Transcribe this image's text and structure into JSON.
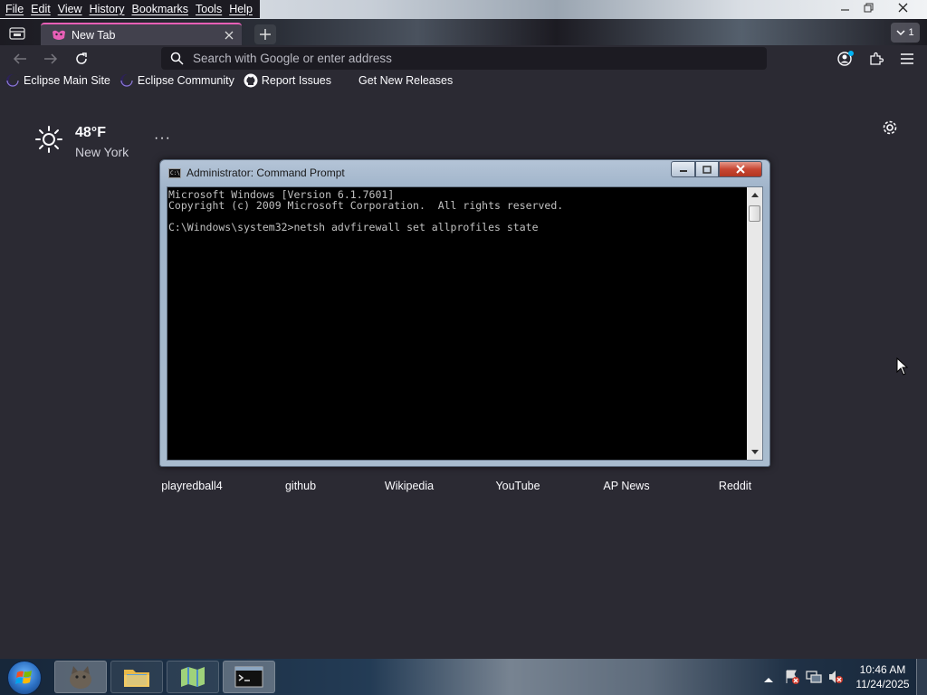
{
  "menu": {
    "items": [
      "File",
      "Edit",
      "View",
      "History",
      "Bookmarks",
      "Tools",
      "Help"
    ]
  },
  "tabs": {
    "active_title": "New Tab",
    "list_all_count": "1"
  },
  "urlbar": {
    "placeholder": "Search with Google or enter address"
  },
  "bookmarks": [
    {
      "label": "Eclipse Main Site",
      "icon": "eclipse-icon"
    },
    {
      "label": "Eclipse Community",
      "icon": "eclipse-icon"
    },
    {
      "label": "Report Issues",
      "icon": "github-icon"
    },
    {
      "label": "Get New Releases",
      "icon": "none"
    }
  ],
  "weather": {
    "temperature": "48°F",
    "city": "New York",
    "icon": "sun-icon",
    "more": "···"
  },
  "shortcuts": [
    "playredball4",
    "github",
    "Wikipedia",
    "YouTube",
    "AP News",
    "Reddit"
  ],
  "cmd": {
    "title": "Administrator: Command Prompt",
    "console_text": "Microsoft Windows [Version 6.1.7601]\nCopyright (c) 2009 Microsoft Corporation.  All rights reserved.\n\nC:\\Windows\\system32>netsh advfirewall set allprofiles state"
  },
  "taskbar": {
    "time": "10:46 AM",
    "date": "11/24/2025"
  },
  "colors": {
    "page_bg": "#2b2a33",
    "tab_accent": "#e85fb6",
    "console_bg": "#000000",
    "console_text": "#c0c0c0"
  }
}
